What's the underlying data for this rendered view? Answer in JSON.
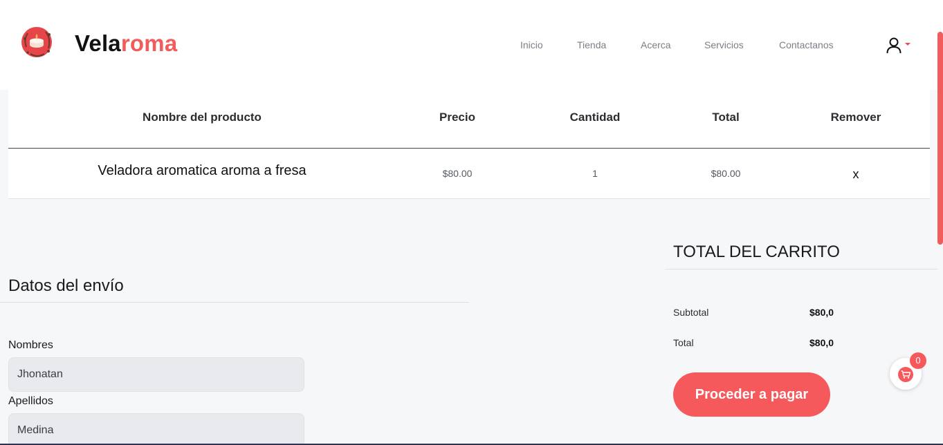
{
  "brand": {
    "part1": "Vela",
    "part2": "roma"
  },
  "nav": {
    "items": [
      "Inicio",
      "Tienda",
      "Acerca",
      "Servicios",
      "Contactanos"
    ]
  },
  "icons": {
    "user": "user-icon",
    "caret": "caret-down-icon",
    "cart": "shopping-cart-icon",
    "logo": "candle-logo-icon"
  },
  "colors": {
    "accent": "#f5595c",
    "brand_accent": "#f25c5c",
    "input_bg": "#e8eaed"
  },
  "cart_table": {
    "headers": [
      "Nombre del producto",
      "Precio",
      "Cantidad",
      "Total",
      "Remover"
    ],
    "rows": [
      {
        "name": "Veladora aromatica aroma a fresa",
        "price": "$80.00",
        "quantity": "1",
        "total": "$80.00",
        "remove": "x"
      }
    ]
  },
  "shipping": {
    "title": "Datos del envío",
    "fields": [
      {
        "label": "Nombres",
        "value": "Jhonatan"
      },
      {
        "label": "Apellidos",
        "value": "Medina"
      }
    ]
  },
  "totals": {
    "title": "TOTAL DEL CARRITO",
    "subtotal_label": "Subtotal",
    "subtotal_value": "$80,0",
    "total_label": "Total",
    "total_value": "$80,0",
    "pay_button": "Proceder a pagar"
  },
  "floating_cart": {
    "count": "0"
  }
}
